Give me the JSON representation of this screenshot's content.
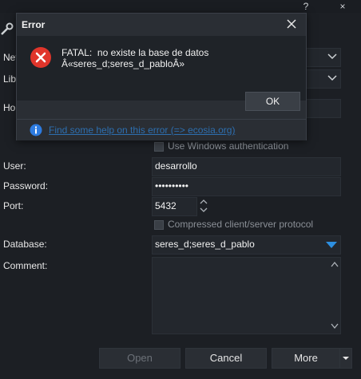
{
  "window_controls": {
    "help_label": "?",
    "close_label": "×"
  },
  "form": {
    "labels": {
      "network": "Net",
      "library": "Lib",
      "host": "Ho",
      "user": "User:",
      "password": "Password:",
      "port": "Port:",
      "database": "Database:",
      "comment": "Comment:"
    },
    "user_value": "desarrollo",
    "password_mask": "••••••••••",
    "port_value": "5432",
    "database_value": "seres_d;seres_d_pablo",
    "use_windows_auth": "Use Windows authentication",
    "compressed_protocol": "Compressed client/server protocol"
  },
  "footer": {
    "open_label": "Open",
    "cancel_label": "Cancel",
    "more_label": "More"
  },
  "error_dialog": {
    "title": "Error",
    "message": "FATAL:  no existe la base de datos\nÂ«seres_d;seres_d_pabloÂ»",
    "ok_label": "OK",
    "help_link": "Find some help on this error (=> ecosia.org)"
  },
  "colors": {
    "error_red": "#e0352b",
    "info_blue": "#2d7be0",
    "accent_blue": "#2d8fe0",
    "link": "#2d6fb0"
  }
}
